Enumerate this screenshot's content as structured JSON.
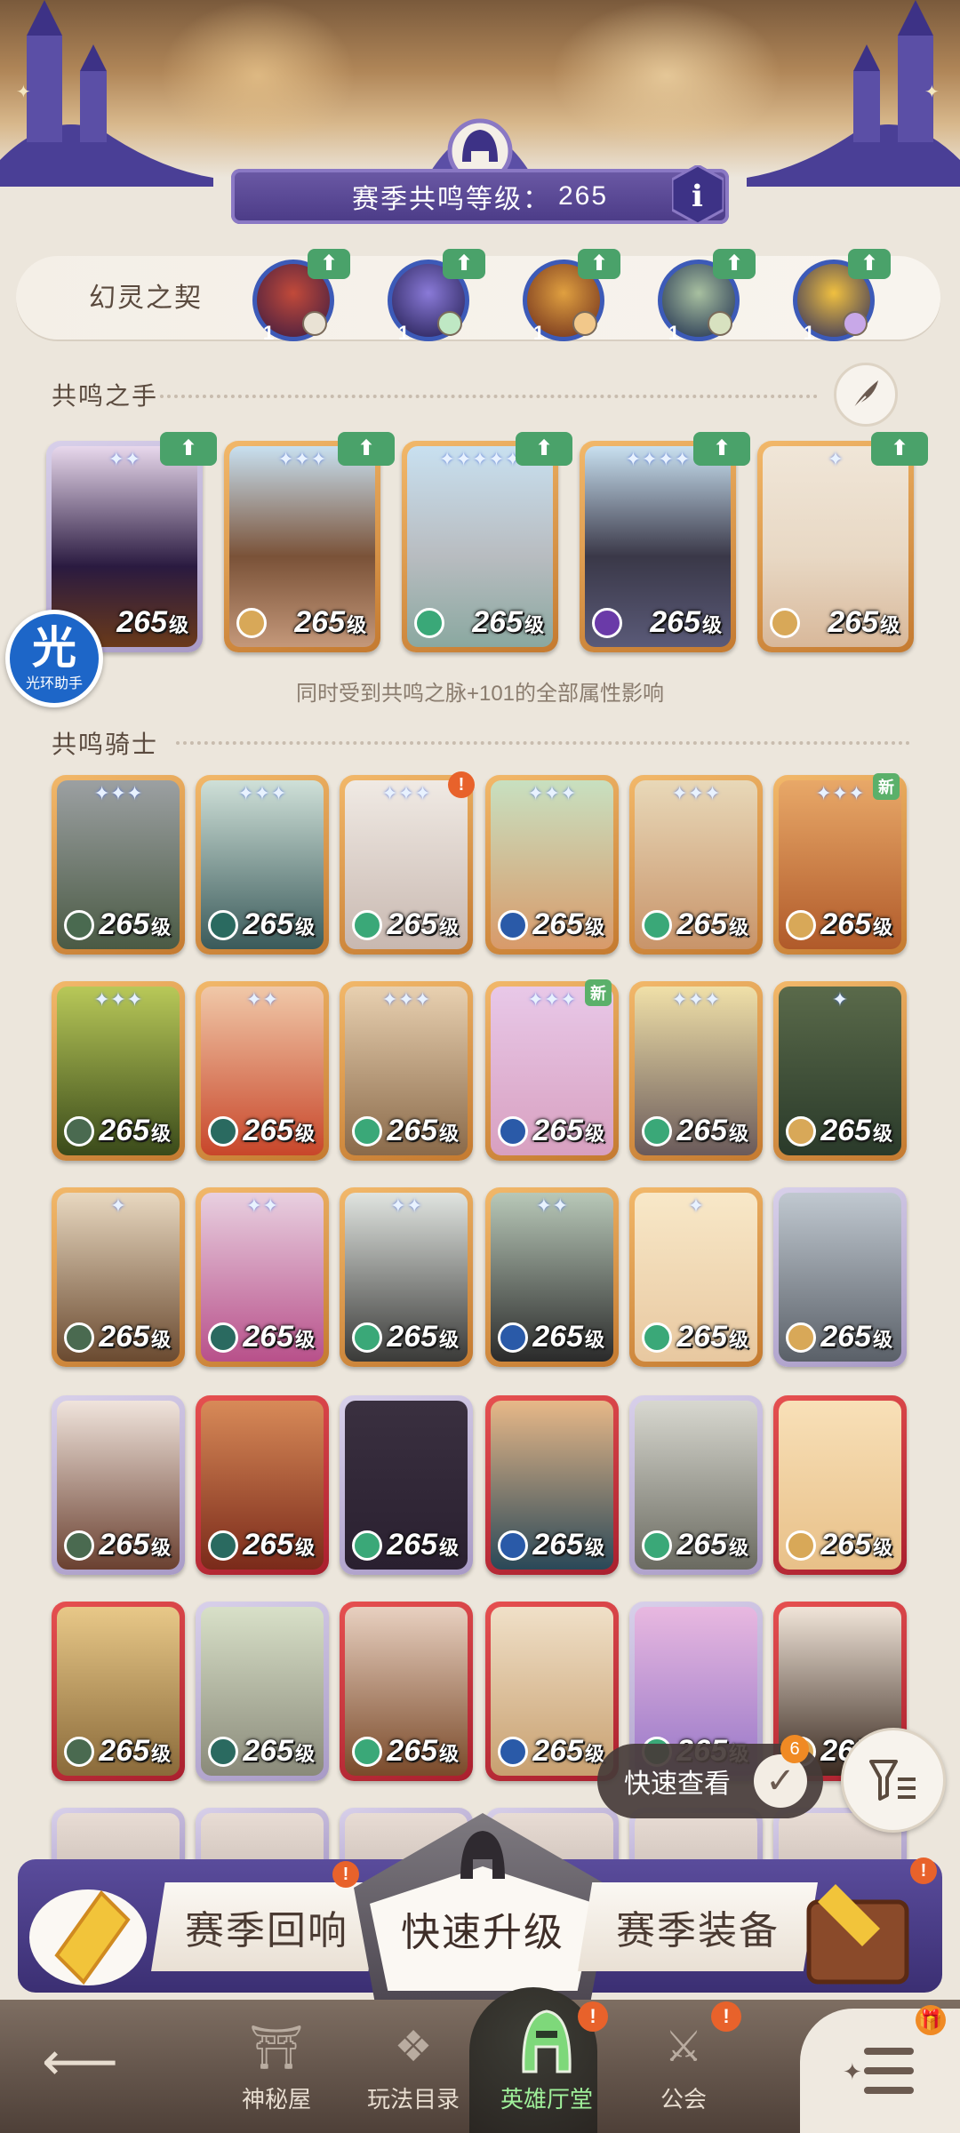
{
  "header": {
    "season_label": "赛季共鸣等级：",
    "season_level": "265"
  },
  "pact": {
    "title": "幻灵之契",
    "slots": [
      "1",
      "1",
      "1",
      "1",
      "1"
    ]
  },
  "resonance_hands": {
    "title": "共鸣之手",
    "cards": [
      {
        "level": "265",
        "unit": "级"
      },
      {
        "level": "265",
        "unit": "级"
      },
      {
        "level": "265",
        "unit": "级"
      },
      {
        "level": "265",
        "unit": "级"
      },
      {
        "level": "265",
        "unit": "级"
      }
    ],
    "hint": "同时受到共鸣之脉+101的全部属性影响"
  },
  "assistant": {
    "glyph": "光",
    "name": "光环助手"
  },
  "resonance_knights": {
    "title": "共鸣骑士",
    "level": "265",
    "unit": "级",
    "new_badge": "新",
    "alert_badge": "!"
  },
  "quick_view": {
    "label": "快速查看",
    "count": "6"
  },
  "actions": {
    "season_echo": "赛季回响",
    "quick_upgrade": "快速升级",
    "season_gear": "赛季装备"
  },
  "nav": {
    "items": [
      {
        "label": "神秘屋"
      },
      {
        "label": "玩法目录"
      },
      {
        "label": "英雄厅堂"
      },
      {
        "label": "公会"
      }
    ]
  },
  "colors": {
    "accent_purple": "#4a3a86",
    "gold_frame": "#c47a30",
    "red_frame": "#a91f2e",
    "active_nav": "#9ff09a"
  }
}
